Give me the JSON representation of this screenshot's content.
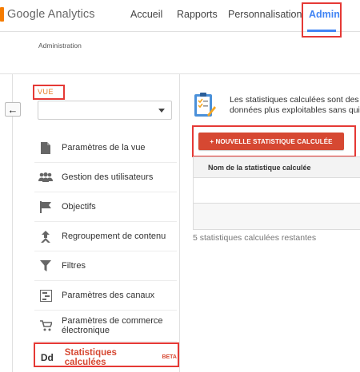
{
  "app": {
    "logo_text": "Google Analytics",
    "brand_color": "#f57c00"
  },
  "nav": {
    "accueil": "Accueil",
    "rapports": "Rapports",
    "personnalisation": "Personnalisation",
    "admin": "Admin",
    "active_color": "#4285f4"
  },
  "breadcrumb": "Administration",
  "sidebar": {
    "vue_label": "VUE",
    "vue_selected": "",
    "items": [
      {
        "label": "Paramètres de la vue",
        "icon": "document-icon"
      },
      {
        "label": "Gestion des utilisateurs",
        "icon": "users-icon"
      },
      {
        "label": "Objectifs",
        "icon": "flag-icon"
      },
      {
        "label": "Regroupement de contenu",
        "icon": "content-grouping-icon"
      },
      {
        "label": "Filtres",
        "icon": "filter-icon"
      },
      {
        "label": "Paramètres des canaux",
        "icon": "channels-icon"
      },
      {
        "label": "Paramètres de commerce électronique",
        "icon": "cart-icon"
      },
      {
        "label": "Statistiques calculées",
        "icon": "calculated-metrics-icon",
        "badge": "BETA",
        "active": true
      }
    ]
  },
  "main": {
    "info_text_line1": "Les statistiques calculées sont des",
    "info_text_line2": "données plus exploitables sans quit",
    "new_button": "+ NOUVELLE STATISTIQUE CALCULÉE",
    "table_header": "Nom de la statistique calculée",
    "remaining": "5 statistiques calculées restantes",
    "button_color": "#d64832"
  },
  "highlight_color": "#e53935"
}
